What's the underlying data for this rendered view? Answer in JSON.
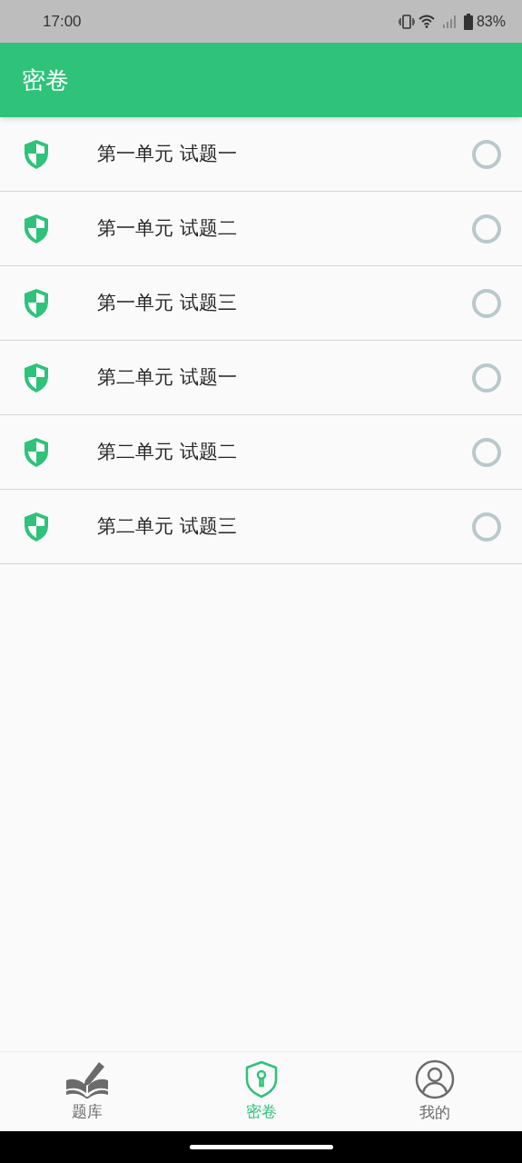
{
  "status_bar": {
    "time": "17:00",
    "battery": "83%"
  },
  "header": {
    "title": "密卷"
  },
  "papers": [
    {
      "title": "第一单元 试题一",
      "checked": false
    },
    {
      "title": "第一单元 试题二",
      "checked": false
    },
    {
      "title": "第一单元 试题三",
      "checked": false
    },
    {
      "title": "第二单元 试题一",
      "checked": false
    },
    {
      "title": "第二单元 试题二",
      "checked": false
    },
    {
      "title": "第二单元 试题三",
      "checked": false
    }
  ],
  "tabs": [
    {
      "label": "题库",
      "kind": "book",
      "selected": false
    },
    {
      "label": "密卷",
      "kind": "shield",
      "selected": true
    },
    {
      "label": "我的",
      "kind": "user",
      "selected": false
    }
  ]
}
